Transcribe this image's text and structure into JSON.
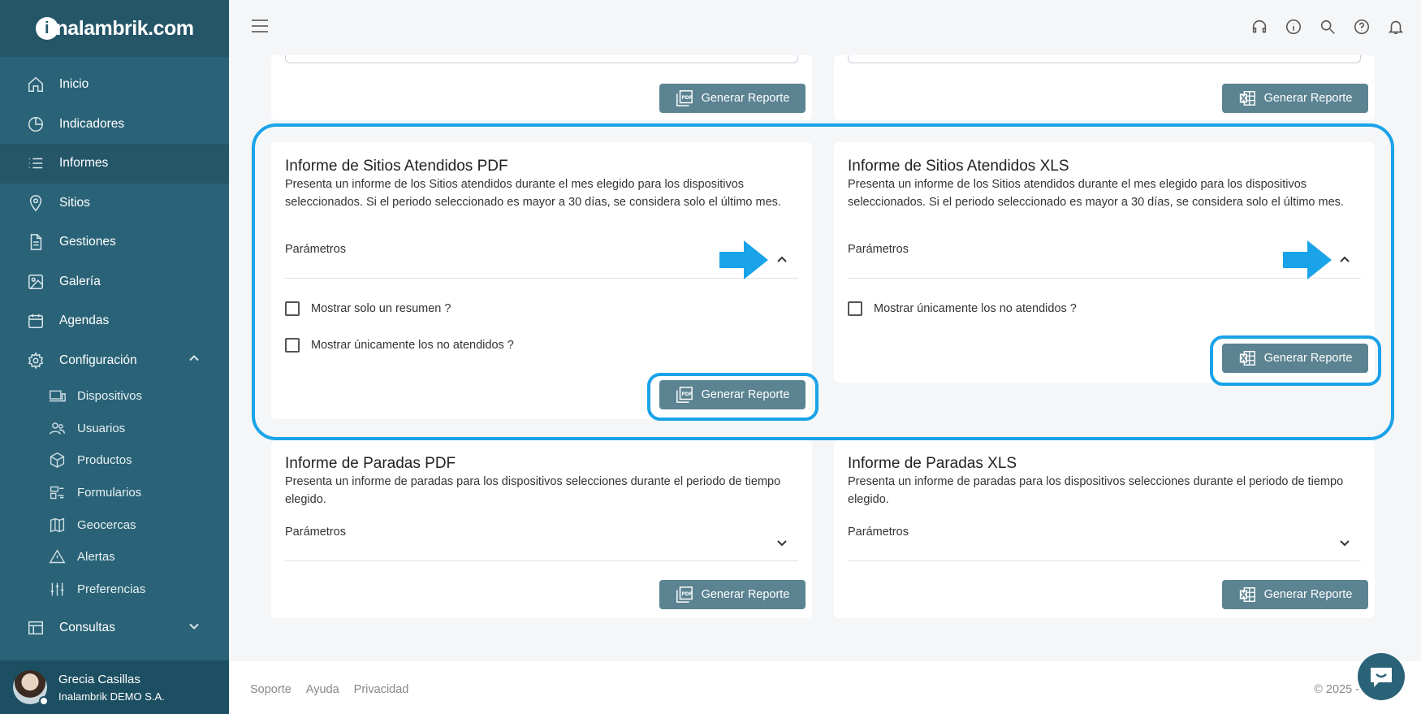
{
  "brand": {
    "logo_letter": "i",
    "logo_text": "nalambrik.com"
  },
  "sidebar": {
    "items": [
      {
        "label": "Inicio",
        "icon": "home-icon"
      },
      {
        "label": "Indicadores",
        "icon": "pie-chart-icon"
      },
      {
        "label": "Informes",
        "icon": "list-icon",
        "active": true
      },
      {
        "label": "Sitios",
        "icon": "location-pin-icon"
      },
      {
        "label": "Gestiones",
        "icon": "document-icon"
      },
      {
        "label": "Galería",
        "icon": "image-icon"
      },
      {
        "label": "Agendas",
        "icon": "calendar-icon"
      },
      {
        "label": "Configuración",
        "icon": "gear-icon",
        "expanded": true
      }
    ],
    "subitems": [
      {
        "label": "Dispositivos",
        "icon": "devices-icon"
      },
      {
        "label": "Usuarios",
        "icon": "users-icon"
      },
      {
        "label": "Productos",
        "icon": "box-icon"
      },
      {
        "label": "Formularios",
        "icon": "forms-icon"
      },
      {
        "label": "Geocercas",
        "icon": "map-icon"
      },
      {
        "label": "Alertas",
        "icon": "warning-icon"
      },
      {
        "label": "Preferencias",
        "icon": "sliders-icon"
      }
    ],
    "consultas": {
      "label": "Consultas",
      "icon": "table-icon"
    },
    "user": {
      "name": "Grecia Casillas",
      "org": "Inalambrik DEMO S.A."
    }
  },
  "topbar": {
    "icons": [
      "headset-icon",
      "info-icon",
      "search-icon",
      "help-icon",
      "bell-icon"
    ]
  },
  "reports": {
    "generate_label": "Generar Reporte",
    "params_label": "Parámetros",
    "sitios_pdf": {
      "title": "Informe de Sitios Atendidos PDF",
      "desc": "Presenta un informe de los Sitios atendidos durante el mes elegido para los dispositivos seleccionados. Si el periodo seleccionado es mayor a 30 días, se considera solo el último mes.",
      "options": [
        "Mostrar solo un resumen ?",
        "Mostrar únicamente los no atendidos ?"
      ]
    },
    "sitios_xls": {
      "title": "Informe de Sitios Atendidos XLS",
      "desc": "Presenta un informe de los Sitios atendidos durante el mes elegido para los dispositivos seleccionados. Si el periodo seleccionado es mayor a 30 días, se considera solo el último mes.",
      "options": [
        "Mostrar únicamente los no atendidos ?"
      ]
    },
    "paradas_pdf": {
      "title": "Informe de Paradas PDF",
      "desc": "Presenta un informe de paradas para los dispositivos selecciones durante el periodo de tiempo elegido."
    },
    "paradas_xls": {
      "title": "Informe de Paradas XLS",
      "desc": "Presenta un informe de paradas para los dispositivos selecciones durante el periodo de tiempo elegido."
    }
  },
  "footer": {
    "links": [
      "Soporte",
      "Ayuda",
      "Privacidad"
    ],
    "copyright": "© 2025 -"
  },
  "colors": {
    "sidebar": "#2a6377",
    "button": "#5b8391",
    "highlight": "#1aa3e8"
  }
}
